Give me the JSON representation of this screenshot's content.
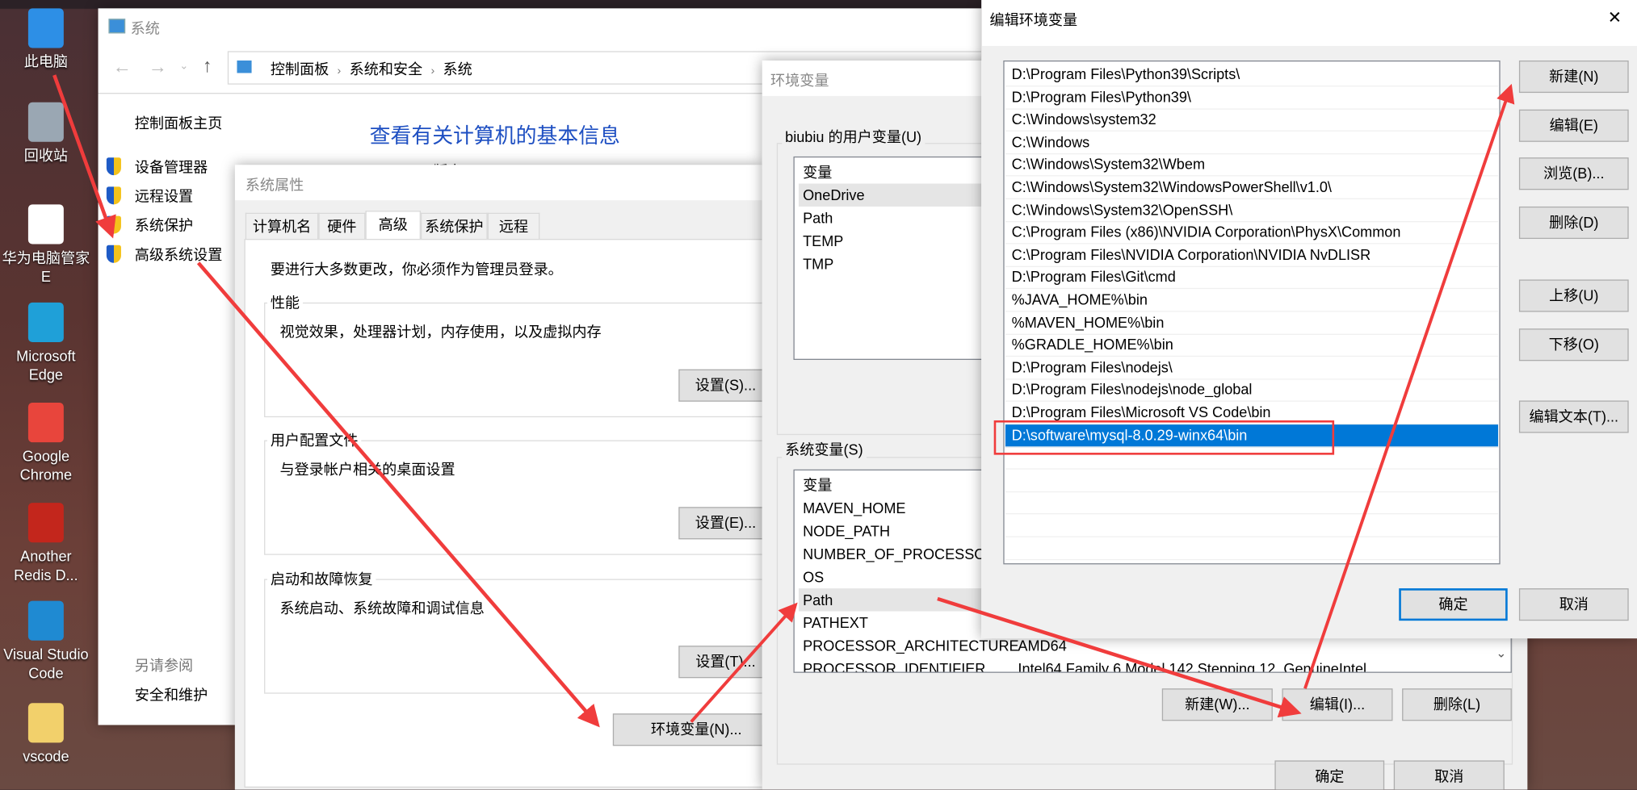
{
  "desktop": {
    "icons": [
      {
        "label": "此电脑",
        "icon": "computer-icon",
        "color": "#2d8fe6"
      },
      {
        "label": "回收站",
        "icon": "recycle-bin-icon",
        "color": "#9aa7b3"
      },
      {
        "label": "华为电脑管家 E",
        "icon": "huawei-pc-manager-icon",
        "color": "#ffffff"
      },
      {
        "label": "Microsoft Edge",
        "icon": "edge-icon",
        "color": "#1fa0d8"
      },
      {
        "label": "Google Chrome",
        "icon": "chrome-icon",
        "color": "#e8453c"
      },
      {
        "label": "Another Redis D...",
        "icon": "redis-icon",
        "color": "#c3261c"
      },
      {
        "label": "Visual Studio Code",
        "icon": "vscode-icon",
        "color": "#1f8ad2"
      },
      {
        "label": "vscode",
        "icon": "folder-icon",
        "color": "#f2d06b"
      }
    ]
  },
  "system_window": {
    "title": "系统",
    "breadcrumb": [
      "控制面板",
      "系统和安全",
      "系统"
    ],
    "sidebar_home": "控制面板主页",
    "sidebar_items": [
      "设备管理器",
      "远程设置",
      "系统保护",
      "高级系统设置"
    ],
    "see_also": "另请参阅",
    "see_also_items": [
      "安全和维护"
    ],
    "heading": "查看有关计算机的基本信息",
    "partial_text": "Windows 版本"
  },
  "system_properties": {
    "title": "系统属性",
    "tabs": [
      "计算机名",
      "硬件",
      "高级",
      "系统保护",
      "远程"
    ],
    "active_tab": "高级",
    "admin_notice": "要进行大多数更改，你必须作为管理员登录。",
    "groups": [
      {
        "label": "性能",
        "desc": "视觉效果，处理器计划，内存使用，以及虚拟内存",
        "button": "设置(S)..."
      },
      {
        "label": "用户配置文件",
        "desc": "与登录帐户相关的桌面设置",
        "button": "设置(E)..."
      },
      {
        "label": "启动和故障恢复",
        "desc": "系统启动、系统故障和调试信息",
        "button": "设置(T)..."
      }
    ],
    "env_button": "环境变量(N)..."
  },
  "env_vars": {
    "title": "环境变量",
    "user_group": "biubiu 的用户变量(U)",
    "user_header": "变量",
    "user_vars": [
      "OneDrive",
      "Path",
      "TEMP",
      "TMP"
    ],
    "system_group": "系统变量(S)",
    "system_header": "变量",
    "system_vars": [
      {
        "name": "MAVEN_HOME",
        "value": ""
      },
      {
        "name": "NODE_PATH",
        "value": ""
      },
      {
        "name": "NUMBER_OF_PROCESSORS",
        "value": ""
      },
      {
        "name": "OS",
        "value": ""
      },
      {
        "name": "Path",
        "value": ""
      },
      {
        "name": "PATHEXT",
        "value": ""
      },
      {
        "name": "PROCESSOR_ARCHITECTURE",
        "value": "AMD64"
      },
      {
        "name": "PROCESSOR_IDENTIFIER",
        "value": "Intel64 Family 6 Model 142 Stepping 12, GenuineIntel"
      }
    ],
    "buttons": {
      "new": "新建(W)...",
      "edit": "编辑(I)...",
      "delete": "删除(L)",
      "ok": "确定",
      "cancel": "取消"
    }
  },
  "edit_env": {
    "title": "编辑环境变量",
    "close": "✕",
    "entries": [
      "D:\\Program Files\\Python39\\Scripts\\",
      "D:\\Program Files\\Python39\\",
      "C:\\Windows\\system32",
      "C:\\Windows",
      "C:\\Windows\\System32\\Wbem",
      "C:\\Windows\\System32\\WindowsPowerShell\\v1.0\\",
      "C:\\Windows\\System32\\OpenSSH\\",
      "C:\\Program Files (x86)\\NVIDIA Corporation\\PhysX\\Common",
      "C:\\Program Files\\NVIDIA Corporation\\NVIDIA NvDLISR",
      "D:\\Program Files\\Git\\cmd",
      "%JAVA_HOME%\\bin",
      "%MAVEN_HOME%\\bin",
      "%GRADLE_HOME%\\bin",
      "D:\\Program Files\\nodejs\\",
      "D:\\Program Files\\nodejs\\node_global",
      "D:\\Program Files\\Microsoft VS Code\\bin",
      "D:\\software\\mysql-8.0.29-winx64\\bin"
    ],
    "selected_entry": "D:\\software\\mysql-8.0.29-winx64\\bin",
    "buttons": {
      "new": "新建(N)",
      "edit": "编辑(E)",
      "browse": "浏览(B)...",
      "delete": "删除(D)",
      "up": "上移(U)",
      "down": "下移(O)",
      "edit_text": "编辑文本(T)...",
      "ok": "确定",
      "cancel": "取消"
    }
  },
  "colors": {
    "accent": "#0078d7",
    "annotation": "#f03c3c",
    "heading": "#1e4fc2"
  }
}
